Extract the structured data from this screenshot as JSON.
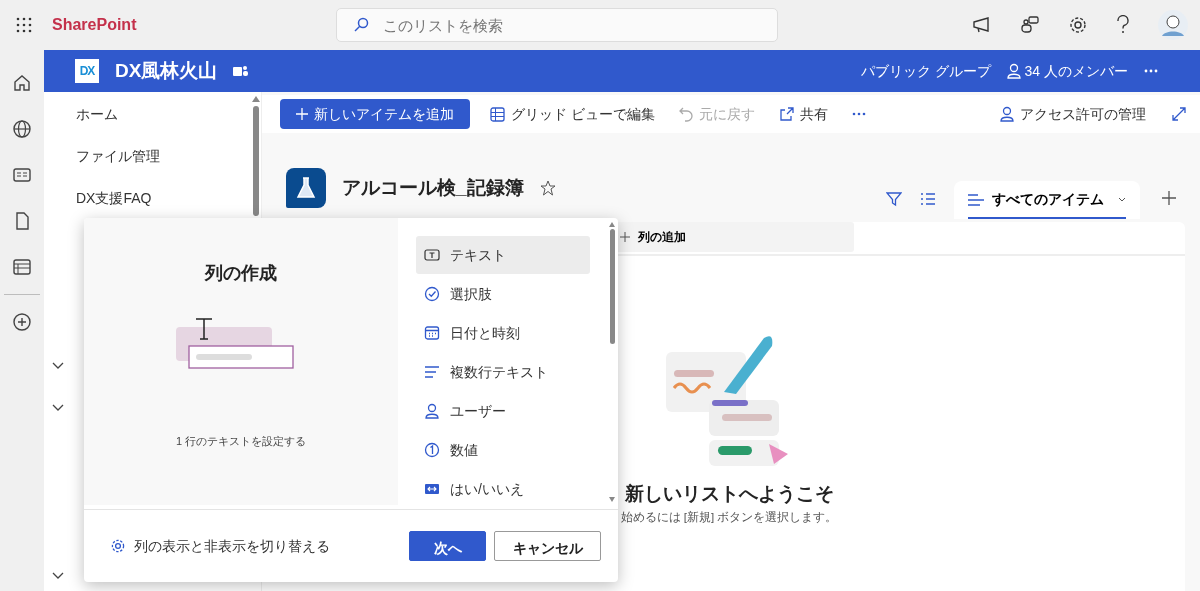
{
  "app_name": "SharePoint",
  "search": {
    "placeholder": "このリストを検索"
  },
  "site": {
    "logo": "DX",
    "title": "DX風林火山",
    "privacy": "パブリック グループ",
    "members": "34 人のメンバー"
  },
  "nav": {
    "items": [
      {
        "label": "ホーム",
        "kind": "link"
      },
      {
        "label": "ファイル管理",
        "kind": "link"
      },
      {
        "label": "DX支援FAQ",
        "kind": "link"
      },
      {
        "kind": "link"
      },
      {
        "kind": "link"
      },
      {
        "kind": "link"
      },
      {
        "kind": "group"
      },
      {
        "kind": "group"
      },
      {
        "kind": "link"
      },
      {
        "kind": "link"
      },
      {
        "kind": "link"
      },
      {
        "kind": "group"
      }
    ]
  },
  "command_bar": {
    "items": [
      {
        "label": "新しいアイテムを追加",
        "kind": "add",
        "disabled": false
      },
      {
        "label": "グリッド ビューで編集",
        "kind": "grid",
        "disabled": false
      },
      {
        "label": "元に戻す",
        "kind": "undo",
        "disabled": true
      },
      {
        "label": "共有",
        "kind": "share",
        "disabled": false
      }
    ],
    "access": "アクセス許可の管理"
  },
  "list": {
    "title": "アルコール検_記録簿",
    "favorite": false
  },
  "views": [
    {
      "label": "すべてのアイテム",
      "selected": true
    }
  ],
  "grid": {
    "add_column": "列の追加"
  },
  "empty": {
    "title": "新しいリストへようこそ",
    "hint": "始めるには [新規] ボタンを選択します。"
  },
  "dialog": {
    "title": "列の作成",
    "description": "1 行のテキストを設定する",
    "types": [
      {
        "label": "テキスト",
        "kind": "text",
        "selected": true
      },
      {
        "label": "選択肢",
        "kind": "choice",
        "selected": false
      },
      {
        "label": "日付と時刻",
        "kind": "date",
        "selected": false
      },
      {
        "label": "複数行テキスト",
        "kind": "multiline",
        "selected": false
      },
      {
        "label": "ユーザー",
        "kind": "person",
        "selected": false
      },
      {
        "label": "数値",
        "kind": "number",
        "selected": false
      },
      {
        "label": "はい/いいえ",
        "kind": "yesno",
        "selected": false
      }
    ],
    "toggle_link": "列の表示と非表示を切り替える",
    "buttons": [
      {
        "label": "次へ",
        "kind": "primary"
      },
      {
        "label": "キャンセル",
        "kind": "default"
      }
    ]
  }
}
